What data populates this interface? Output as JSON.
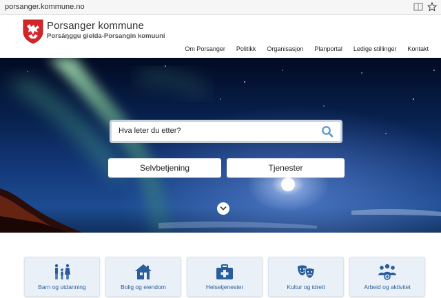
{
  "browser": {
    "url": "porsanger.kommune.no"
  },
  "header": {
    "site_name": "Porsanger kommune",
    "site_sub": "Porsáŋggu gielda-Porsangin komuuni",
    "nav": [
      "Om Porsanger",
      "Politikk",
      "Organisasjon",
      "Planportal",
      "Ledige stillinger",
      "Kontakt"
    ]
  },
  "hero": {
    "search_placeholder": "Hva leter du etter?",
    "btn_selvbetjening": "Selvbetjening",
    "btn_tjenester": "Tjenester"
  },
  "cards": [
    {
      "label": "Barn og utdanning",
      "icon": "family-icon"
    },
    {
      "label": "Bolig og eiendom",
      "icon": "house-icon"
    },
    {
      "label": "Helsetjenester",
      "icon": "medical-kit-icon"
    },
    {
      "label": "Kultur og idrett",
      "icon": "theater-masks-icon"
    },
    {
      "label": "Arbeid og aktivitet",
      "icon": "people-group-icon"
    }
  ],
  "colors": {
    "accent": "#2a5d9a",
    "card_bg": "#eaf0f8",
    "hero_sky": "#143a7c"
  }
}
